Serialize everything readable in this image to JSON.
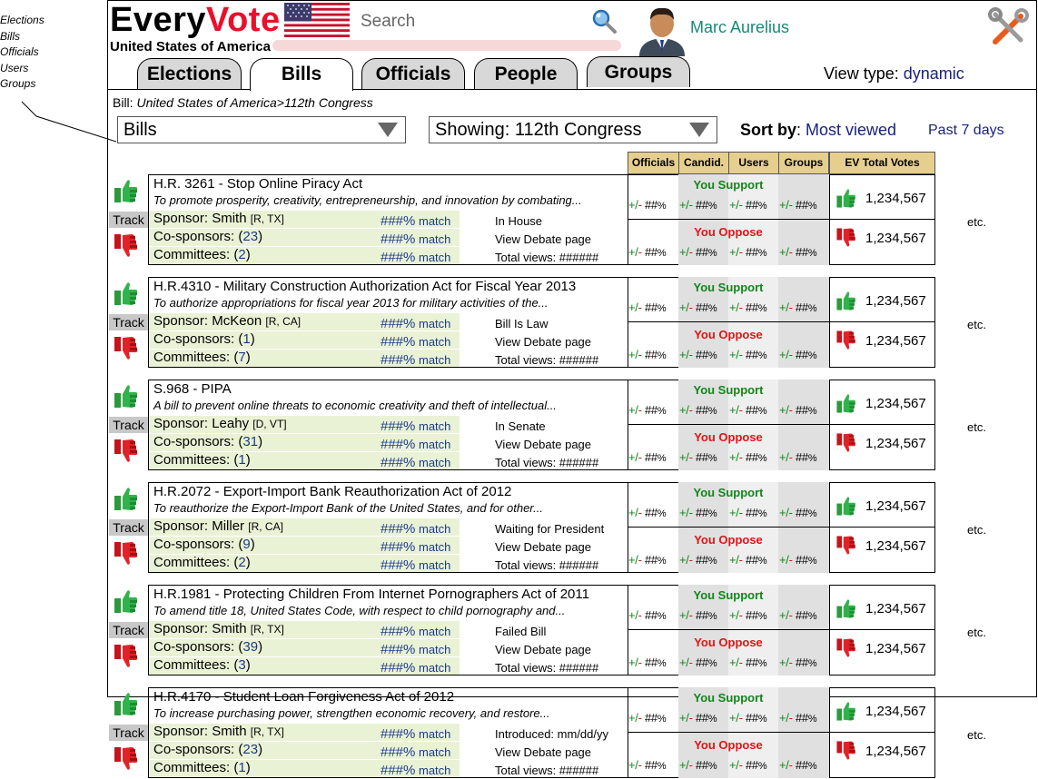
{
  "side_nav": [
    "Elections",
    "Bills",
    "Officials",
    "Users",
    "Groups"
  ],
  "header": {
    "logo_every": "Every",
    "logo_vote": "Vote",
    "country": "United States of America",
    "search_placeholder": "Search",
    "user_name": "Marc Aurelius"
  },
  "tabs": [
    {
      "label": "Elections"
    },
    {
      "label": "Bills"
    },
    {
      "label": "Officials"
    },
    {
      "label": "People"
    },
    {
      "label": "Groups"
    }
  ],
  "view_type": {
    "label": "View type:",
    "value": "dynamic"
  },
  "breadcrumb": {
    "prefix": "Bill:",
    "path": "United States of America>112th Congress"
  },
  "filters": {
    "category": "Bills",
    "showing": "Showing: 112th Congress",
    "sort_label": "Sort by",
    "sort_value": "Most viewed",
    "period": "Past 7 days"
  },
  "columns": [
    "Officials",
    "Candid.",
    "Users",
    "Groups",
    "EV Total Votes"
  ],
  "labels": {
    "track": "Track",
    "sponsor": "Sponsor:",
    "cosponsors": "Co-sponsors:",
    "committees": "Committees:",
    "match": "match",
    "match_pct": "###%",
    "debate": "View Debate page",
    "total_views": "Total views: ######",
    "support": "You Support",
    "oppose": "You Oppose",
    "pm_plus": "+/",
    "pm_minus": "-",
    "pm_hash": " ##",
    "pm_pct": "%",
    "etc": "etc."
  },
  "bills": [
    {
      "title": "H.R. 3261 - Stop Online Piracy Act",
      "desc": "To promote prosperity, creativity, entrepreneurship, and innovation by combating...",
      "sponsor": "Smith",
      "party": "[R, TX]",
      "cosponsors": "23",
      "committees": "2",
      "status": "In House",
      "support_total": "1,234,567",
      "oppose_total": "1,234,567"
    },
    {
      "title": "H.R.4310 - Military Construction Authorization Act for Fiscal Year 2013",
      "desc": "To authorize appropriations for fiscal year 2013 for military activities of the...",
      "sponsor": "McKeon",
      "party": "[R, CA]",
      "cosponsors": "1",
      "committees": "7",
      "status": "Bill Is Law",
      "support_total": "1,234,567",
      "oppose_total": "1,234,567"
    },
    {
      "title": "S.968 - PIPA",
      "desc": "A bill to prevent online threats to economic creativity and theft of intellectual...",
      "sponsor": "Leahy",
      "party": "[D, VT]",
      "cosponsors": "31",
      "committees": "1",
      "status": "In Senate",
      "support_total": "1,234,567",
      "oppose_total": "1,234,567"
    },
    {
      "title": "H.R.2072 - Export-Import Bank Reauthorization Act of 2012",
      "desc": "To reauthorize the Export-Import Bank of the United States, and for other...",
      "sponsor": "Miller",
      "party": "[R, CA]",
      "cosponsors": "9",
      "committees": "2",
      "status": "Waiting for President",
      "support_total": "1,234,567",
      "oppose_total": "1,234,567"
    },
    {
      "title": "H.R.1981 - Protecting Children From Internet Pornographers Act of 2011",
      "desc": "To amend title 18, United States Code, with respect to child pornography and...",
      "sponsor": "Smith",
      "party": "[R, TX]",
      "cosponsors": "39",
      "committees": "3",
      "status": "Failed Bill",
      "support_total": "1,234,567",
      "oppose_total": "1,234,567"
    },
    {
      "title": "H.R.4170 - Student Loan Forgiveness Act of 2012",
      "desc": "To increase purchasing power, strengthen economic recovery, and restore...",
      "sponsor": "Smith",
      "party": "[R, TX]",
      "cosponsors": "23",
      "committees": "1",
      "status": "Introduced: mm/dd/yy",
      "support_total": "1,234,567",
      "oppose_total": "1,234,567"
    }
  ]
}
